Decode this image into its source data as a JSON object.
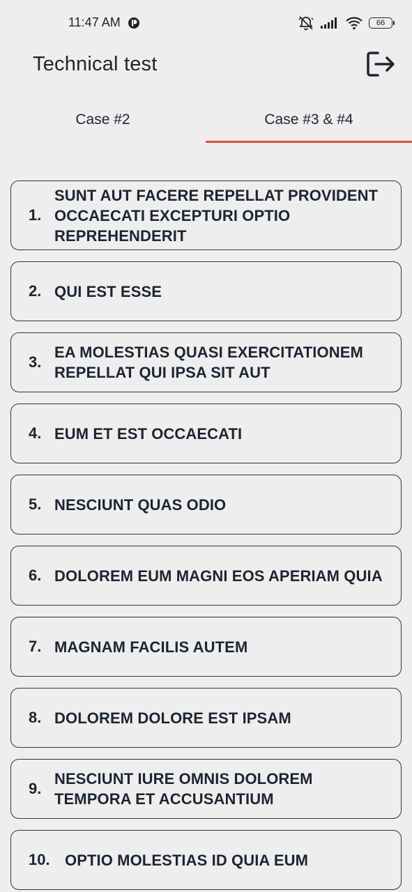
{
  "status_bar": {
    "time": "11:47 AM",
    "battery_level": "66"
  },
  "app_bar": {
    "title": "Technical test"
  },
  "tabs": [
    {
      "label": "Case #2",
      "selected": false
    },
    {
      "label": "Case #3 & #4",
      "selected": true
    }
  ],
  "posts": [
    {
      "number": "1.",
      "title": "SUNT AUT FACERE REPELLAT PROVIDENT OCCAECATI EXCEPTURI OPTIO REPREHENDERIT"
    },
    {
      "number": "2.",
      "title": "QUI EST ESSE"
    },
    {
      "number": "3.",
      "title": "EA MOLESTIAS QUASI EXERCITATIONEM REPELLAT QUI IPSA SIT AUT"
    },
    {
      "number": "4.",
      "title": "EUM ET EST OCCAECATI"
    },
    {
      "number": "5.",
      "title": "NESCIUNT QUAS ODIO"
    },
    {
      "number": "6.",
      "title": "DOLOREM EUM MAGNI EOS APERIAM QUIA"
    },
    {
      "number": "7.",
      "title": "MAGNAM FACILIS AUTEM"
    },
    {
      "number": "8.",
      "title": "DOLOREM DOLORE EST IPSAM"
    },
    {
      "number": "9.",
      "title": "NESCIUNT IURE OMNIS DOLOREM TEMPORA ET ACCUSANTIUM"
    },
    {
      "number": "10.",
      "title": "OPTIO MOLESTIAS ID QUIA EUM"
    }
  ],
  "colors": {
    "accent": "#e0503f",
    "text": "#1c2532",
    "background": "#eeeeee",
    "card_border": "#2b3645"
  },
  "icons": {
    "app_status": "app-notification-icon",
    "mute": "bell-muted-icon",
    "signal": "signal-bars-icon",
    "wifi": "wifi-icon",
    "battery": "battery-icon",
    "logout": "logout-icon"
  }
}
